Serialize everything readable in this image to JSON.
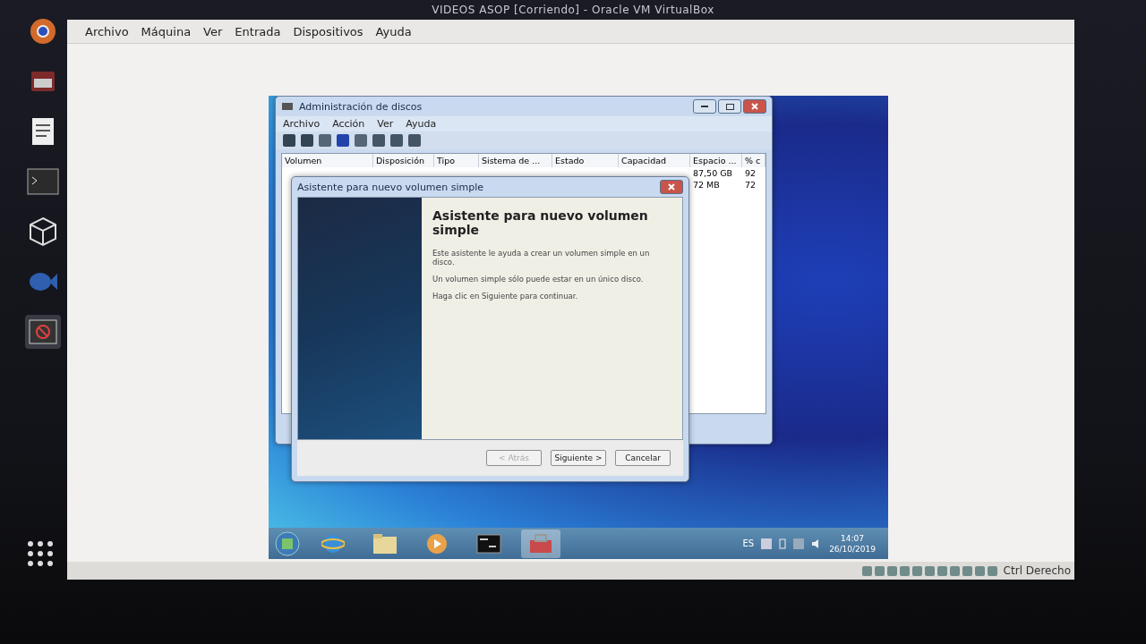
{
  "top_bar": {
    "title": "VIDEOS ASOP [Corriendo] - Oracle VM VirtualBox"
  },
  "dock": {
    "items": [
      {
        "kind": "browser",
        "selected": false
      },
      {
        "kind": "files",
        "selected": false
      },
      {
        "kind": "document",
        "selected": false
      },
      {
        "kind": "terminal",
        "selected": false
      },
      {
        "kind": "cube",
        "selected": false
      },
      {
        "kind": "fish",
        "selected": false
      },
      {
        "kind": "vm",
        "selected": true
      }
    ]
  },
  "vm_menu": [
    "Archivo",
    "Máquina",
    "Ver",
    "Entrada",
    "Dispositivos",
    "Ayuda"
  ],
  "disk_window": {
    "title": "Administración de discos",
    "menu": [
      "Archivo",
      "Acción",
      "Ver",
      "Ayuda"
    ],
    "columns": [
      "Volumen",
      "Disposición",
      "Tipo",
      "Sistema de ...",
      "Estado",
      "Capacidad",
      "Espacio ...",
      "% c"
    ],
    "rows": [
      {
        "free": "87,50 GB",
        "percent": "92"
      },
      {
        "free": "72 MB",
        "percent": "72"
      }
    ]
  },
  "wizard": {
    "title": "Asistente para nuevo volumen simple",
    "heading": "Asistente para nuevo volumen simple",
    "paragraphs": [
      "Este asistente le ayuda a crear un volumen simple en un disco.",
      "Un volumen simple sólo puede estar en un único disco.",
      "Haga clic en Siguiente para continuar."
    ],
    "buttons": [
      {
        "label": "< Atrás",
        "disabled": true
      },
      {
        "label": "Siguiente >",
        "disabled": false
      },
      {
        "label": "Cancelar",
        "disabled": false
      }
    ]
  },
  "taskbar": {
    "items": [
      {
        "kind": "ie",
        "selected": false
      },
      {
        "kind": "folder",
        "selected": false
      },
      {
        "kind": "media",
        "selected": false
      },
      {
        "kind": "cmd",
        "selected": false
      },
      {
        "kind": "toolbox",
        "selected": true
      }
    ],
    "language": "ES",
    "time": "14:07",
    "date": "26/10/2019"
  },
  "status_bar": {
    "host_key": "Ctrl Derecho"
  }
}
